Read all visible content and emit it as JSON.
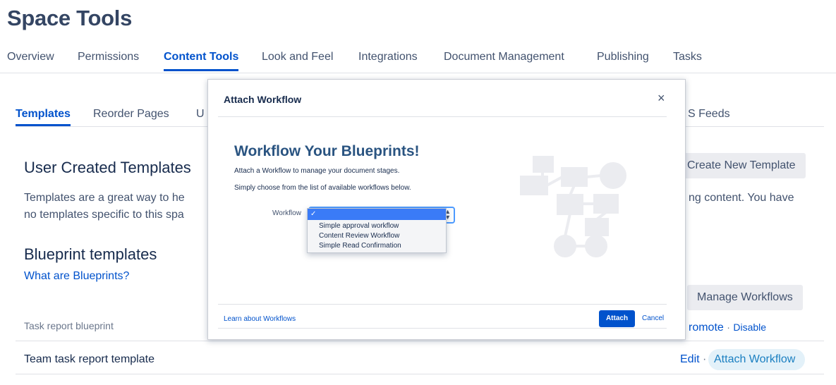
{
  "page_title": "Space Tools",
  "top_tabs": [
    "Overview",
    "Permissions",
    "Content Tools",
    "Look and Feel",
    "Integrations",
    "Document Management",
    "Publishing",
    "Tasks"
  ],
  "sub_tabs": {
    "templates": "Templates",
    "reorder": "Reorder Pages",
    "partial": "U",
    "rss": "S Feeds"
  },
  "user_templates": {
    "heading": "User Created Templates",
    "line1_left": "Templates are a great way to he",
    "line1_right": "ng content. You have",
    "line2": "no templates specific to this spa",
    "create_button": "Create New Template"
  },
  "blueprints": {
    "heading": "Blueprint templates",
    "link": "What are Blueprints?",
    "manage_button": "Manage Workflows",
    "row1_name": "Task report blueprint",
    "row1_promote": "romote",
    "row1_sep": "·",
    "row1_disable": "Disable",
    "row2_name": "Team task report template",
    "row2_edit": "Edit",
    "row2_sep": "·",
    "row2_attach": "Attach Workflow"
  },
  "dialog": {
    "title": "Attach Workflow",
    "close": "×",
    "heading": "Workflow Your Blueprints!",
    "text1": "Attach a Workflow to manage your document stages.",
    "text2": "Simply choose from the list of available workflows below.",
    "workflow_label": "Workflow",
    "selected_mark": "✓",
    "options": [
      "Simple approval workflow",
      "Content Review Workflow",
      "Simple Read Confirmation"
    ],
    "learn_link": "Learn about Workflows",
    "attach_button": "Attach",
    "cancel": "Cancel"
  },
  "colors": {
    "accent": "#0052cc",
    "heading_blue": "#2a5481",
    "graphic": "#ebecf0"
  }
}
